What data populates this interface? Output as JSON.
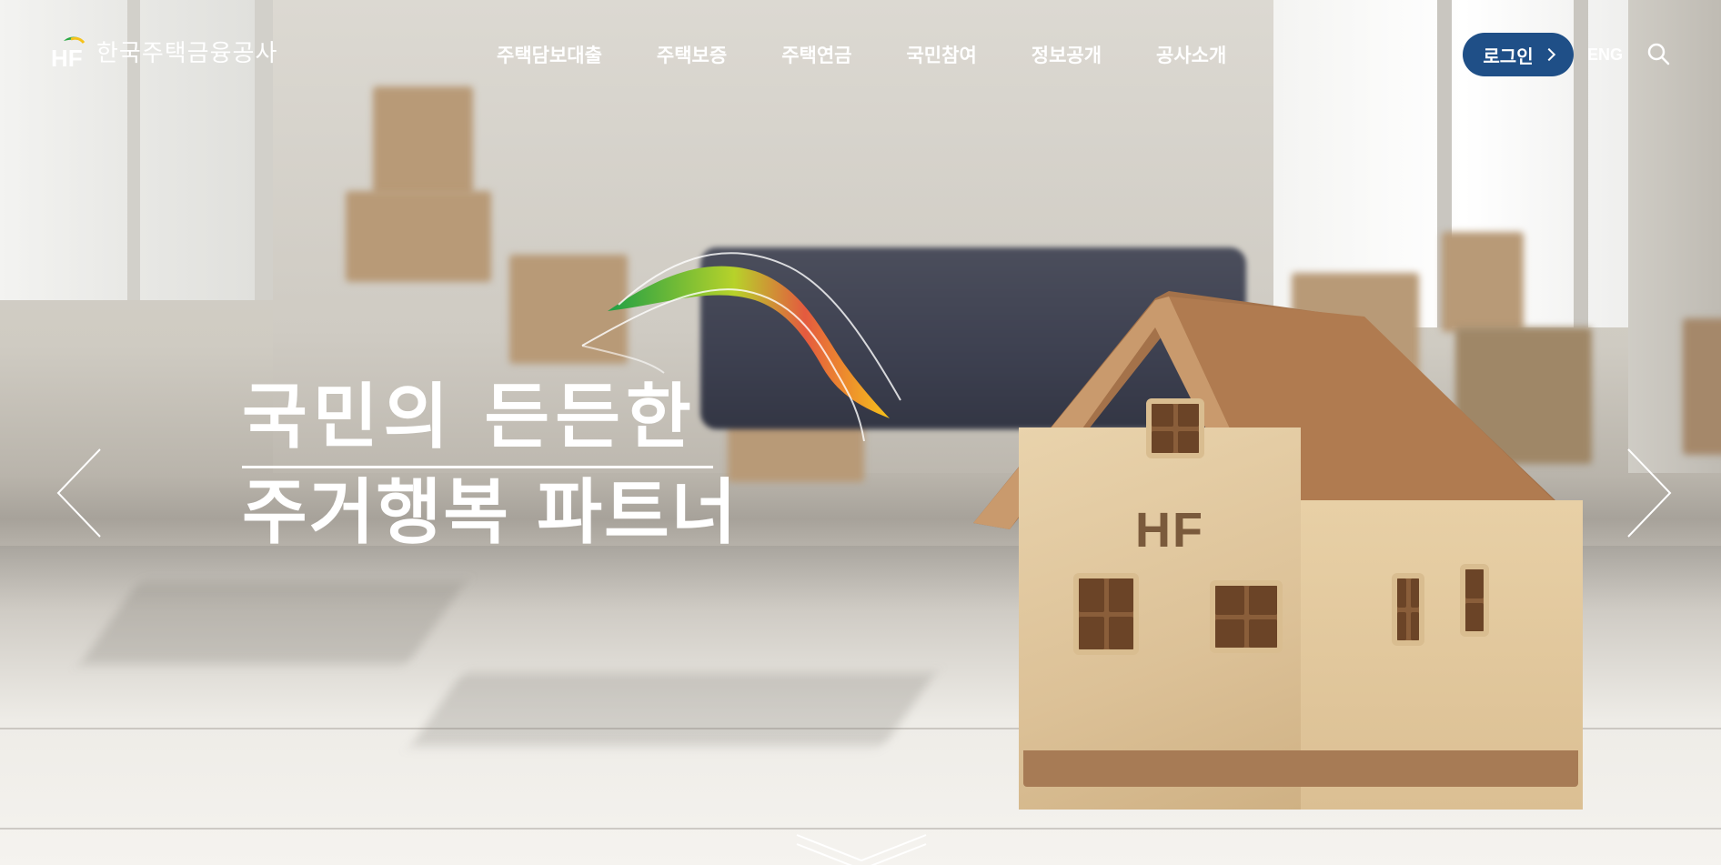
{
  "header": {
    "brand_name": "한국주택금융공사",
    "logo_mark": "HF",
    "nav": [
      {
        "label": "주택담보대출"
      },
      {
        "label": "주택보증"
      },
      {
        "label": "주택연금"
      },
      {
        "label": "국민참여"
      },
      {
        "label": "정보공개"
      },
      {
        "label": "공사소개"
      }
    ],
    "login_label": "로그인",
    "lang_label": "ENG",
    "search_icon": "search-icon"
  },
  "hero": {
    "headline_line1": "국민의 든든한",
    "headline_line2": "주거행복 파트너",
    "house_logo": "HF",
    "prev_icon": "chevron-left-icon",
    "next_icon": "chevron-right-icon",
    "scroll_icon": "scroll-down-icon"
  },
  "colors": {
    "login_bg": "#1f4f87",
    "ribbon_green": "#2aa844",
    "ribbon_yellow": "#f6c21a",
    "ribbon_red": "#e0503a",
    "text_white": "#ffffff"
  }
}
